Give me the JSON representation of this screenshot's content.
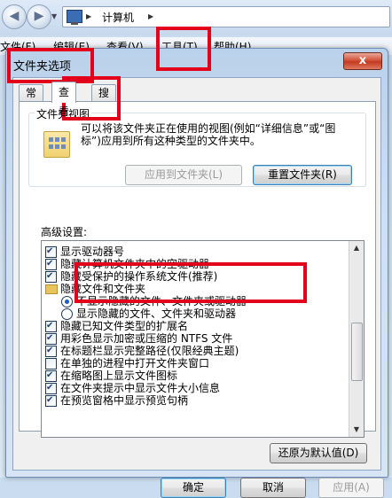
{
  "explorer": {
    "breadcrumb": "计算机",
    "menu": [
      "文件(F)",
      "编辑(E)",
      "查看(V)",
      "工具(T)",
      "帮助(H)"
    ]
  },
  "dialog": {
    "title": "文件夹选项",
    "close_label": "x",
    "tabs": [
      "常规",
      "查看",
      "搜索"
    ],
    "active_tab": "查看",
    "folder_views": {
      "legend": "文件夹视图",
      "description": "可以将该文件夹正在使用的视图(例如“详细信息”或“图标”)应用到所有这种类型的文件夹中。",
      "apply_button": "应用到文件夹(L)",
      "reset_button": "重置文件夹(R)"
    },
    "advanced": {
      "label": "高级设置:",
      "items": [
        {
          "type": "checkbox",
          "checked": true,
          "label": "显示驱动器号"
        },
        {
          "type": "checkbox",
          "checked": true,
          "label": "隐藏计算机文件夹中的空驱动器"
        },
        {
          "type": "checkbox",
          "checked": true,
          "label": "隐藏受保护的操作系统文件(推荐)"
        },
        {
          "type": "folder",
          "checked": null,
          "label": "隐藏文件和文件夹"
        },
        {
          "type": "radio",
          "checked": true,
          "label": "不显示隐藏的文件、文件夹或驱动器"
        },
        {
          "type": "radio",
          "checked": false,
          "label": "显示隐藏的文件、文件夹和驱动器"
        },
        {
          "type": "checkbox",
          "checked": true,
          "label": "隐藏已知文件类型的扩展名"
        },
        {
          "type": "checkbox",
          "checked": true,
          "label": "用彩色显示加密或压缩的 NTFS 文件"
        },
        {
          "type": "checkbox",
          "checked": true,
          "label": "在标题栏显示完整路径(仅限经典主题)"
        },
        {
          "type": "checkbox",
          "checked": false,
          "label": "在单独的进程中打开文件夹窗口"
        },
        {
          "type": "checkbox",
          "checked": true,
          "label": "在缩略图上显示文件图标"
        },
        {
          "type": "checkbox",
          "checked": true,
          "label": "在文件夹提示中显示文件大小信息"
        },
        {
          "type": "checkbox",
          "checked": true,
          "label": "在预览窗格中显示预览句柄"
        }
      ],
      "restore_button": "还原为默认值(D)"
    },
    "buttons": {
      "ok": "确定",
      "cancel": "取消",
      "apply": "应用(A)"
    }
  },
  "highlights": [
    "工具(T)",
    "文件夹选项",
    "查看",
    "不显示隐藏的文件、文件夹或驱动器"
  ],
  "colors": {
    "highlight": "#e3001b",
    "accent": "#3c7fb1"
  }
}
